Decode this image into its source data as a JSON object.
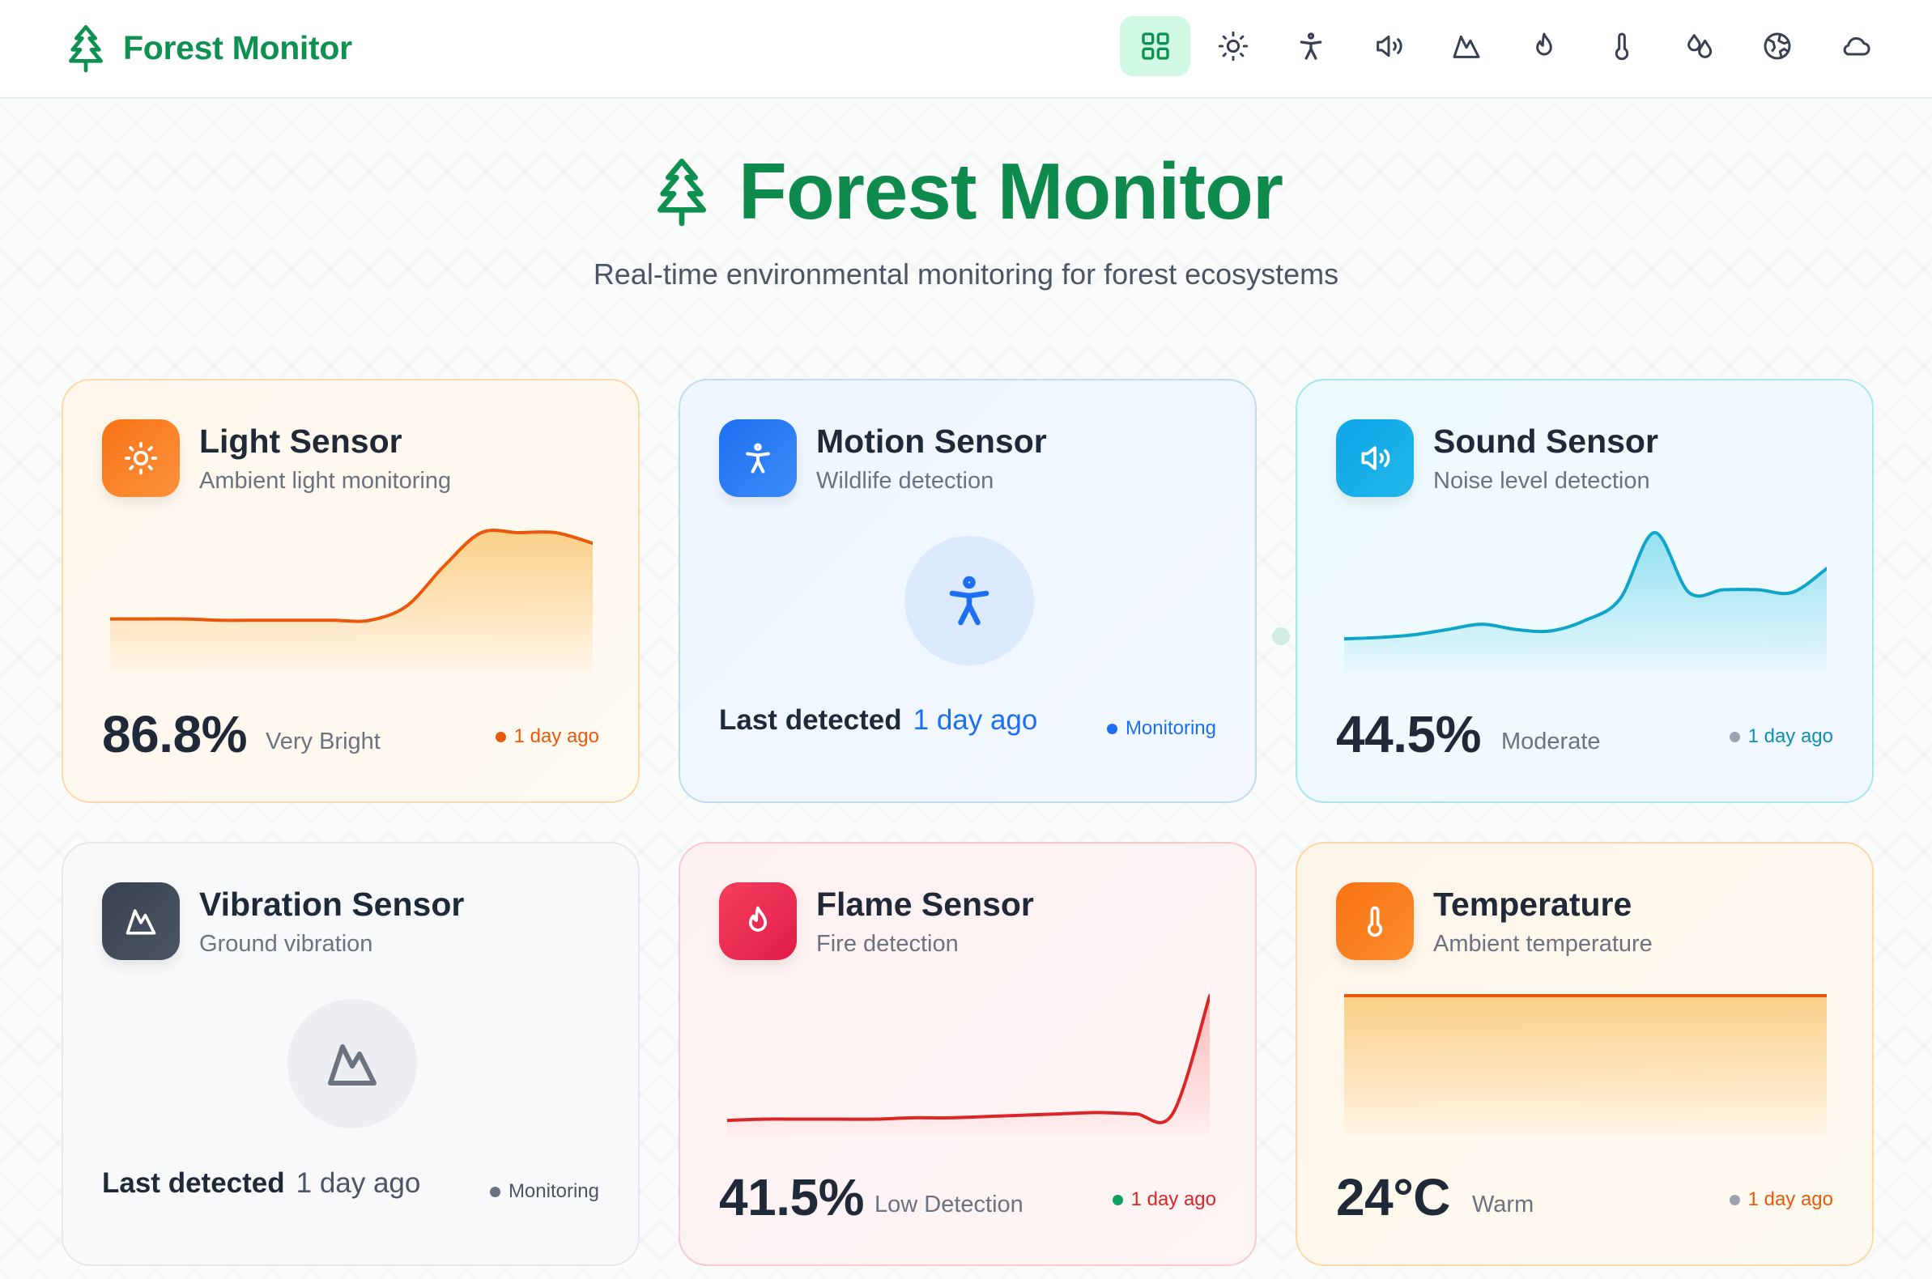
{
  "nav": {
    "brand": "Forest Monitor",
    "icons": [
      "grid-icon",
      "sun-icon",
      "person-icon",
      "speaker-icon",
      "mountain-icon",
      "flame-icon",
      "thermometer-icon",
      "droplets-icon",
      "globe-icon",
      "cloud-icon"
    ],
    "active_index": 0
  },
  "hero": {
    "title": "Forest Monitor",
    "subtitle": "Real-time environmental monitoring for forest ecosystems"
  },
  "colors": {
    "brand_green": "#0e9150",
    "orange": "#ea580c",
    "blue": "#1d6ff2",
    "cyan": "#0ea5c9",
    "red": "#dc2626",
    "gray": "#6b7280"
  },
  "cards": {
    "light": {
      "title": "Light Sensor",
      "subtitle": "Ambient light monitoring",
      "value": "86.8%",
      "value_label": "Very Bright",
      "status": "1 day ago",
      "trend": [
        0.35,
        0.35,
        0.35,
        0.34,
        0.34,
        0.34,
        0.34,
        0.34,
        0.45,
        0.75,
        1.0,
        1.0,
        1.0,
        0.92
      ]
    },
    "motion": {
      "title": "Motion Sensor",
      "subtitle": "Wildlife detection",
      "detect_label": "Last detected",
      "detect_value": "1 day ago",
      "status": "Monitoring"
    },
    "sound": {
      "title": "Sound Sensor",
      "subtitle": "Noise level detection",
      "value": "44.5%",
      "value_label": "Moderate",
      "status": "1 day ago",
      "trend": [
        0.2,
        0.21,
        0.23,
        0.27,
        0.31,
        0.27,
        0.26,
        0.34,
        0.5,
        1.0,
        0.55,
        0.57,
        0.57,
        0.55,
        0.73
      ]
    },
    "vibration": {
      "title": "Vibration Sensor",
      "subtitle": "Ground vibration",
      "detect_label": "Last detected",
      "detect_value": "1 day ago",
      "status": "Monitoring"
    },
    "flame": {
      "title": "Flame Sensor",
      "subtitle": "Fire detection",
      "value": "41.5%",
      "value_label": "Low Detection",
      "status": "1 day ago",
      "trend": [
        0.06,
        0.07,
        0.07,
        0.07,
        0.07,
        0.08,
        0.08,
        0.09,
        0.1,
        0.11,
        0.12,
        0.11,
        0.11,
        1.0
      ]
    },
    "temperature": {
      "title": "Temperature",
      "subtitle": "Ambient temperature",
      "value": "24°C",
      "value_label": "Warm",
      "status": "1 day ago",
      "trend": [
        1.0,
        1.0,
        1.0,
        1.0,
        1.0,
        1.0,
        1.0,
        1.0
      ]
    }
  }
}
